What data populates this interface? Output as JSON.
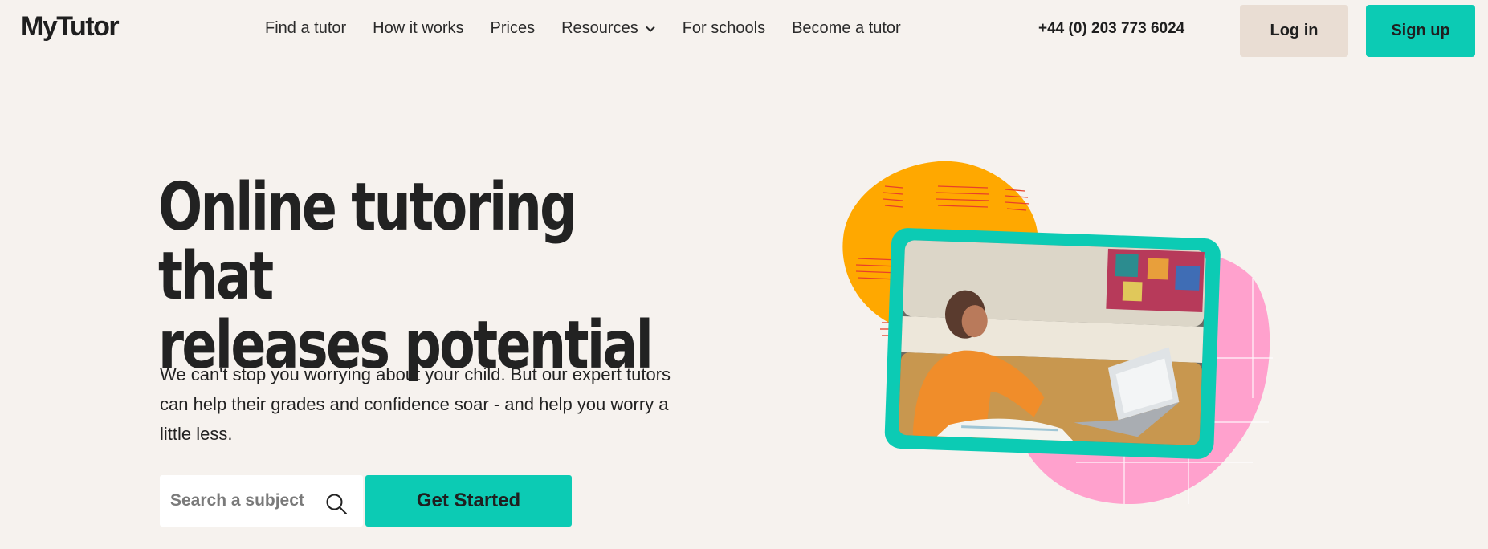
{
  "header": {
    "logo": "MyTutor",
    "nav": [
      {
        "label": "Find a tutor"
      },
      {
        "label": "How it works"
      },
      {
        "label": "Prices"
      },
      {
        "label": "Resources"
      },
      {
        "label": "For schools"
      },
      {
        "label": "Become a tutor"
      }
    ],
    "phone": "+44 (0) 203 773 6024",
    "login_label": "Log in",
    "signup_label": "Sign up"
  },
  "hero": {
    "title_line1": "Online tutoring that",
    "title_line2": "releases potential",
    "body": "We can't stop you worrying about your child. But our expert tutors can help their grades and confidence soar - and help you worry a little less.",
    "search_placeholder": "Search a subject",
    "cta_label": "Get Started"
  },
  "icons": {
    "dropdown": "chevron-down-icon",
    "search": "search-icon"
  },
  "colors": {
    "background": "#f6f2ee",
    "accent": "#0ccbb4",
    "login_bg": "#e9ddd3",
    "blob_orange": "#ffa800",
    "blob_pink": "#ffa1cd"
  }
}
